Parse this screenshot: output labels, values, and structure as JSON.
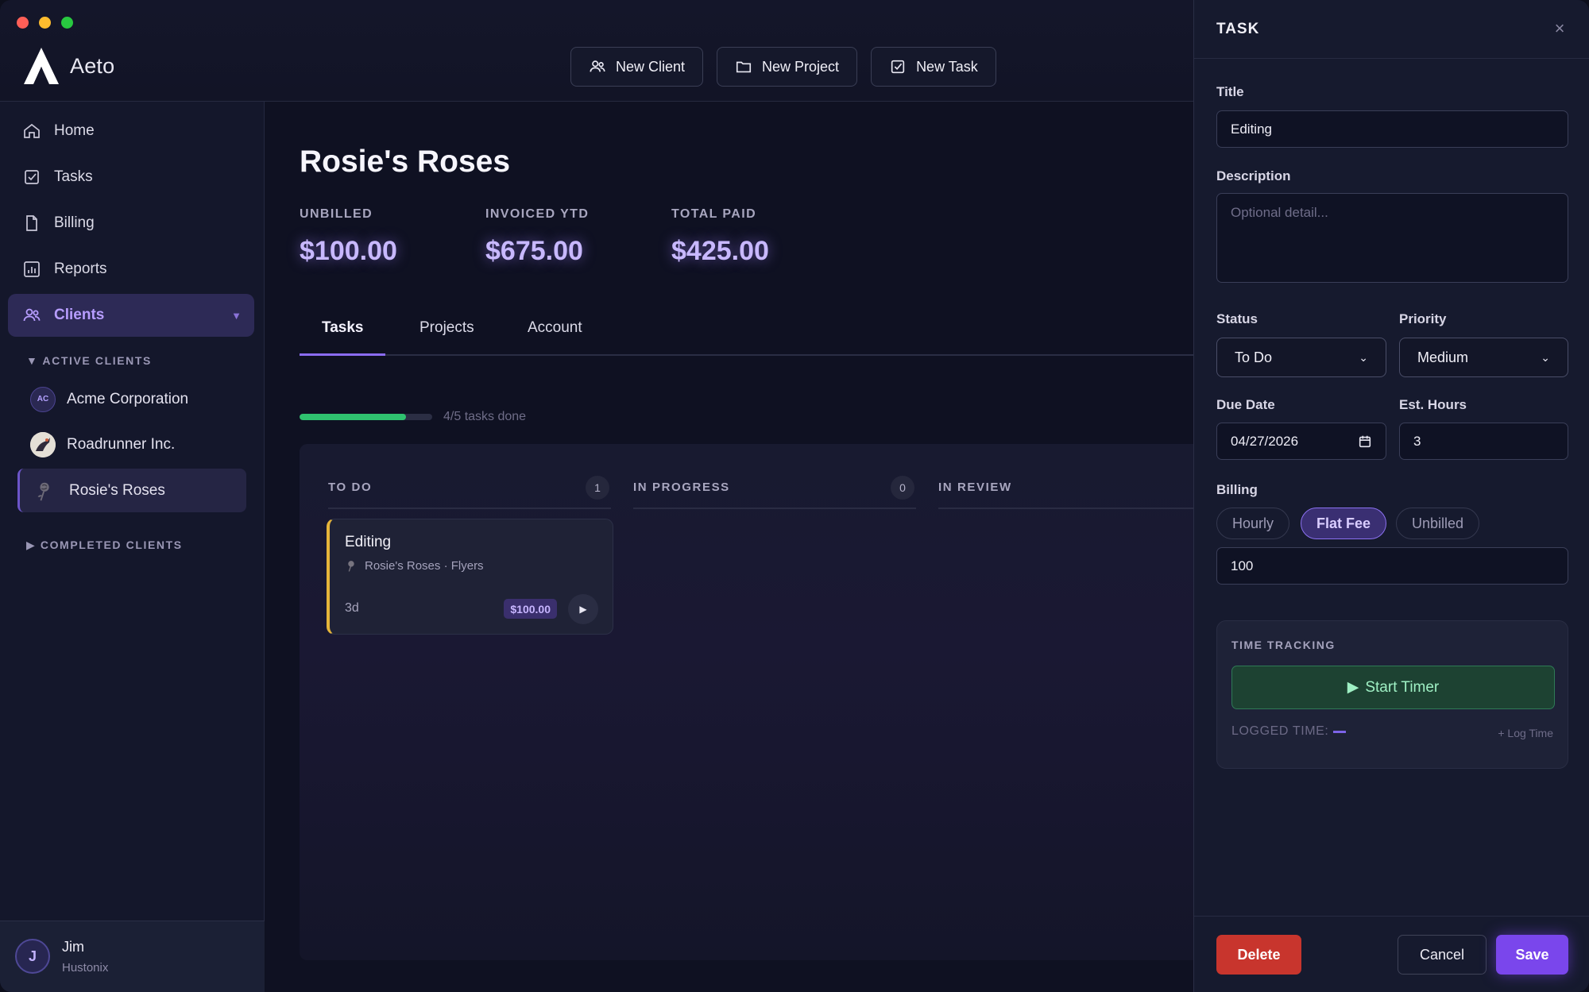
{
  "app": {
    "name": "Aeto"
  },
  "toolbar": {
    "new_client": "New Client",
    "new_project": "New Project",
    "new_task": "New Task"
  },
  "sidebar": {
    "items": [
      {
        "label": "Home",
        "icon": "home-icon"
      },
      {
        "label": "Tasks",
        "icon": "checkbox-icon"
      },
      {
        "label": "Billing",
        "icon": "document-icon"
      },
      {
        "label": "Reports",
        "icon": "chart-icon"
      },
      {
        "label": "Clients",
        "icon": "users-icon"
      }
    ],
    "active_label": "▼ ACTIVE CLIENTS",
    "completed_label": "▶ COMPLETED CLIENTS",
    "clients": [
      {
        "name": "Acme Corporation",
        "initials": "AC"
      },
      {
        "name": "Roadrunner Inc."
      },
      {
        "name": "Rosie's Roses"
      }
    ],
    "user": {
      "initial": "J",
      "name": "Jim",
      "org": "Hustonix"
    }
  },
  "client": {
    "title": "Rosie's Roses",
    "stats": [
      {
        "label": "UNBILLED",
        "value": "$100.00"
      },
      {
        "label": "INVOICED YTD",
        "value": "$675.00"
      },
      {
        "label": "TOTAL PAID",
        "value": "$425.00"
      }
    ],
    "tabs": [
      "Tasks",
      "Projects",
      "Account"
    ],
    "progress": {
      "done": 4,
      "total": 5,
      "text": "4/5 tasks done"
    }
  },
  "board": {
    "columns": [
      {
        "title": "TO DO",
        "count": "1"
      },
      {
        "title": "IN PROGRESS",
        "count": "0"
      },
      {
        "title": "IN REVIEW"
      }
    ],
    "card": {
      "title": "Editing",
      "subtitle": "Rosie's Roses · Flyers",
      "age": "3d",
      "fee": "$100.00"
    }
  },
  "panel": {
    "title": "TASK",
    "title_label": "Title",
    "title_value": "Editing",
    "description_label": "Description",
    "description_placeholder": "Optional detail...",
    "status_label": "Status",
    "status_value": "To Do",
    "priority_label": "Priority",
    "priority_value": "Medium",
    "due_label": "Due Date",
    "due_value": "04/27/2026",
    "hours_label": "Est. Hours",
    "hours_value": "3",
    "billing_label": "Billing",
    "billing_options": [
      "Hourly",
      "Flat Fee",
      "Unbilled"
    ],
    "billing_selected": "Flat Fee",
    "billing_value": "100",
    "time_tracking_label": "TIME TRACKING",
    "start_timer": "Start Timer",
    "logged_time_label": "LOGGED TIME:",
    "log_time": "+ Log Time",
    "delete": "Delete",
    "cancel": "Cancel",
    "save": "Save"
  },
  "colors": {
    "accent": "#8b6cf3",
    "progress": "#2fc26f",
    "danger": "#c8352d",
    "todo_stripe": "#e6b53a"
  }
}
